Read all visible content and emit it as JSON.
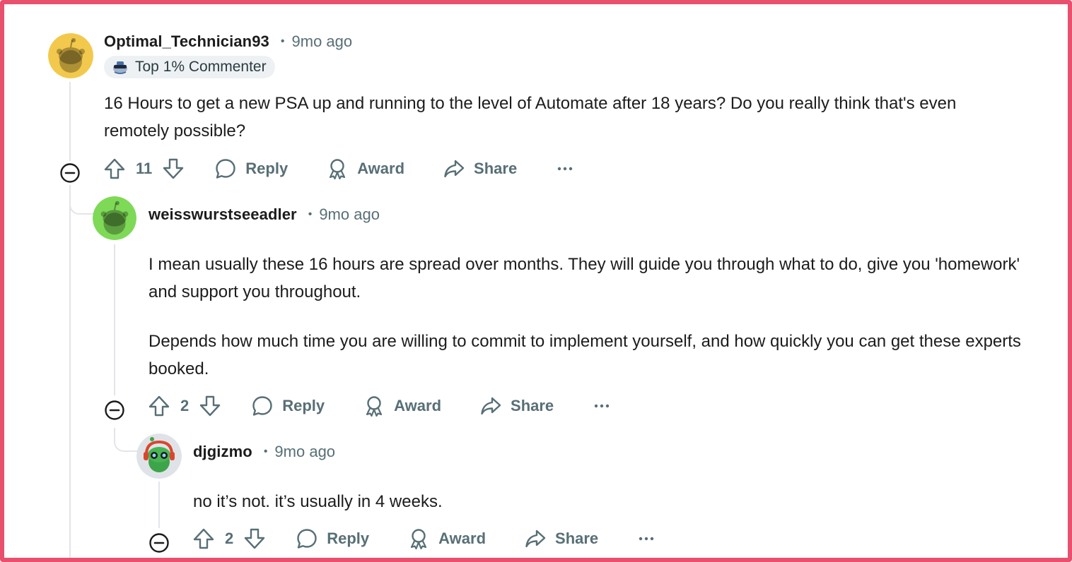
{
  "comments": [
    {
      "author": "Optimal_Technician93",
      "time": "9mo ago",
      "badge": "Top 1% Commenter",
      "paragraphs": [
        "16 Hours to get a new PSA up and running to the level of Automate after 18 years? Do you really think that's even remotely possible?"
      ],
      "votes": "11",
      "reply_label": "Reply",
      "award_label": "Award",
      "share_label": "Share",
      "avatar_color": "#f2c94c"
    },
    {
      "author": "weisswurstseeadler",
      "time": "9mo ago",
      "paragraphs": [
        "I mean usually these 16 hours are spread over months. They will guide you through what to do, give you 'homework' and support you throughout.",
        "Depends how much time you are willing to commit to implement yourself, and how quickly you can get these experts booked."
      ],
      "votes": "2",
      "reply_label": "Reply",
      "award_label": "Award",
      "share_label": "Share",
      "avatar_color": "#7ed957"
    },
    {
      "author": "djgizmo",
      "time": "9mo ago",
      "paragraphs": [
        "no it’s not. it’s usually in 4 weeks."
      ],
      "votes": "2",
      "reply_label": "Reply",
      "award_label": "Award",
      "share_label": "Share",
      "avatar_color": "#dfe3e8"
    }
  ],
  "colors": {
    "frame": "#e8506e",
    "muted": "#576f76",
    "thread_line": "#e2e5e8",
    "badge_bg": "#eef1f3"
  },
  "icons": [
    "collapse-icon",
    "upvote-icon",
    "downvote-icon",
    "reply-icon",
    "award-icon",
    "share-icon",
    "more-icon"
  ]
}
